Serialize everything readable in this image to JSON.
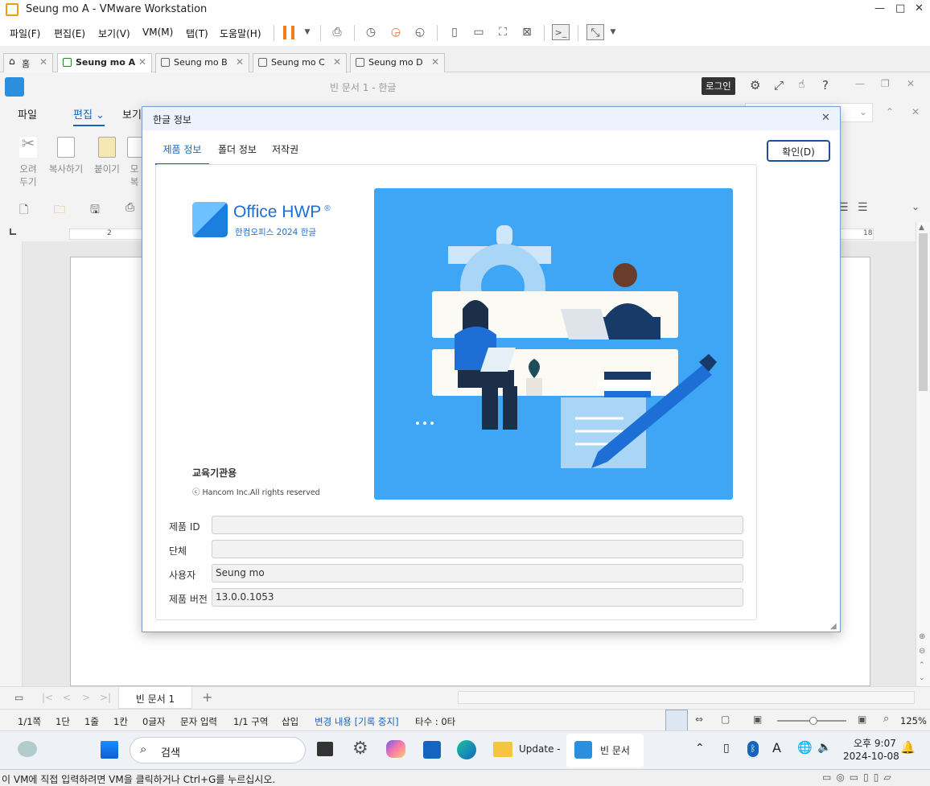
{
  "vmware": {
    "title": "Seung mo A - VMware Workstation",
    "menu": [
      "파일(F)",
      "편집(E)",
      "보기(V)",
      "VM(M)",
      "탭(T)",
      "도움말(H)"
    ],
    "tabs": [
      {
        "label": "홈"
      },
      {
        "label": "Seung mo A"
      },
      {
        "label": "Seung mo B"
      },
      {
        "label": "Seung mo C"
      },
      {
        "label": "Seung mo D"
      }
    ],
    "status_text": "이 VM에 직접 입력하려면 VM을 클릭하거나 Ctrl+G를 누르십시오."
  },
  "hwp": {
    "window_title": "빈 문서 1 - 한글",
    "login_tooltip": "로그인",
    "ribbon_tabs": [
      "파일",
      "편집",
      "보기"
    ],
    "ribbon_buttons": [
      {
        "label": "오려\n두기"
      },
      {
        "label": "복사하기"
      },
      {
        "label": "붙이기"
      },
      {
        "label": "모\n복"
      }
    ],
    "ruler_right": "18",
    "ruler_left": "2",
    "doc_tab": "빈 문서 1",
    "status": {
      "page": "1/1쪽",
      "col": "1단",
      "line": "1줄",
      "kan": "1칸",
      "chars": "0글자",
      "mode": "문자 입력",
      "section": "1/1 구역",
      "insert": "삽입",
      "track": "변경 내용 [기록 중지]",
      "typing": "타수 : 0타",
      "zoom": "125%"
    }
  },
  "dialog": {
    "title": "한글 정보",
    "tabs": [
      "제품 정보",
      "폴더 정보",
      "저작권"
    ],
    "confirm": "확인(D)",
    "logo_main": "Office HWP",
    "logo_reg": "®",
    "logo_sub": "한컴오피스 2024 한글",
    "edu": "교육기관용",
    "copyright": "ⓒ Hancom Inc.All rights reserved",
    "fields": [
      {
        "label": "제품 ID",
        "value": ""
      },
      {
        "label": "단체",
        "value": ""
      },
      {
        "label": "사용자",
        "value": "Seung mo"
      },
      {
        "label": "제품 버전",
        "value": "13.0.0.1053"
      }
    ]
  },
  "taskbar": {
    "search": "검색",
    "update": "Update -",
    "doc": "빈 문서",
    "time": "오후 9:07",
    "date": "2024-10-08"
  },
  "colors": {
    "accent": "#1565c0",
    "illus_bg": "#3fa5f5",
    "pause": "#f07c1a"
  }
}
